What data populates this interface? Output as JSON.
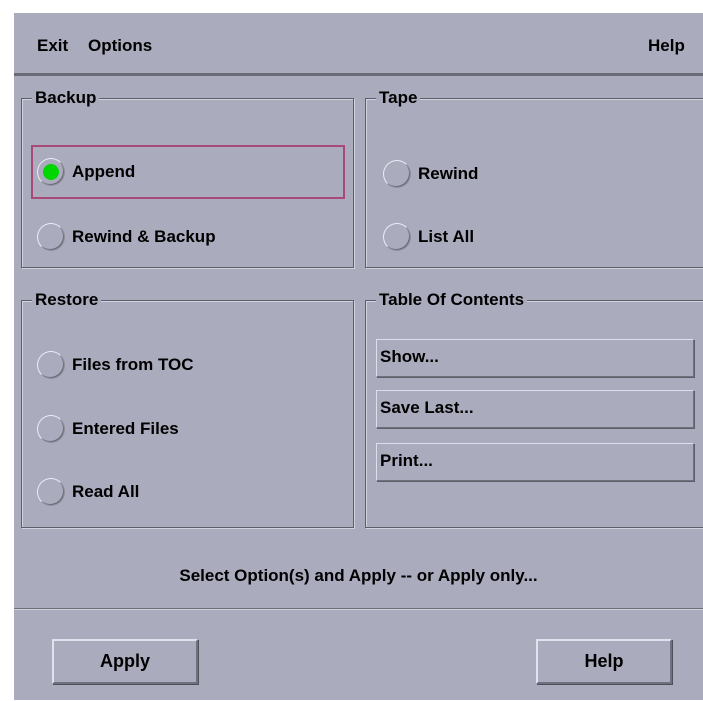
{
  "menu": {
    "exit": "Exit",
    "options": "Options",
    "help": "Help"
  },
  "backup": {
    "title": "Backup",
    "options": [
      {
        "label": "Append",
        "selected": true
      },
      {
        "label": "Rewind & Backup",
        "selected": false
      }
    ]
  },
  "tape": {
    "title": "Tape",
    "options": [
      {
        "label": "Rewind",
        "selected": false
      },
      {
        "label": "List All",
        "selected": false
      }
    ]
  },
  "restore": {
    "title": "Restore",
    "options": [
      {
        "label": "Files from TOC",
        "selected": false
      },
      {
        "label": "Entered Files",
        "selected": false
      },
      {
        "label": "Read All",
        "selected": false
      }
    ]
  },
  "toc": {
    "title": "Table Of Contents",
    "buttons": [
      "Show...",
      "Save Last...",
      "Print..."
    ]
  },
  "status": "Select Option(s) and Apply -- or Apply only...",
  "actions": {
    "apply": "Apply",
    "help": "Help"
  },
  "colors": {
    "window_bg": "#ababbe",
    "radio_selected": "#00d600",
    "focus_border": "#a84a78"
  }
}
